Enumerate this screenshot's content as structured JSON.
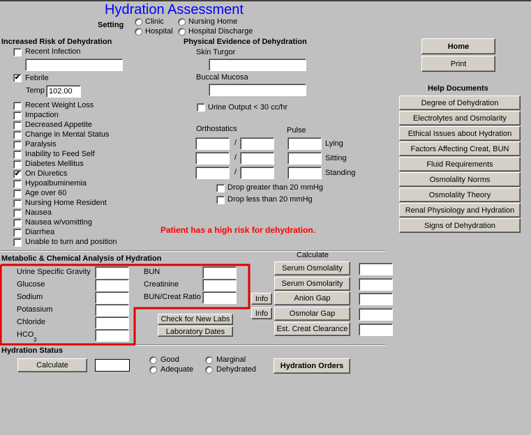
{
  "title": "Hydration Assessment",
  "setting": {
    "label": "Setting",
    "options": [
      "Clinic",
      "Nursing Home",
      "Hospital",
      "Hospital Discharge"
    ]
  },
  "risk": {
    "heading": "Increased Risk of Dehydration",
    "recent_infection": "Recent Infection",
    "recent_infection_value": "",
    "febrile": "Febrile",
    "febrile_checked": true,
    "temp_label": "Temp",
    "temp_value": "102.00",
    "items": [
      {
        "label": "Recent Weight Loss",
        "checked": false
      },
      {
        "label": "Impaction",
        "checked": false
      },
      {
        "label": "Decreased Appetite",
        "checked": false
      },
      {
        "label": "Change in Mental Status",
        "checked": false
      },
      {
        "label": "Paralysis",
        "checked": false
      },
      {
        "label": "Inability to Feed Self",
        "checked": false
      },
      {
        "label": "Diabetes Mellitus",
        "checked": false
      },
      {
        "label": "On Diuretics",
        "checked": true
      },
      {
        "label": "Hypoalbuminemia",
        "checked": false
      },
      {
        "label": "Age over 60",
        "checked": false
      },
      {
        "label": "Nursing Home Resident",
        "checked": false
      },
      {
        "label": "Nausea",
        "checked": false
      },
      {
        "label": "Nausea w/vomitting",
        "checked": false
      },
      {
        "label": "Diarrhea",
        "checked": false
      },
      {
        "label": "Unable to turn and position",
        "checked": false
      }
    ]
  },
  "physical": {
    "heading": "Physical Evidence of Dehydration",
    "skin_turgor": "Skin Turgor",
    "buccal_mucosa": "Buccal Mucosa",
    "urine_output": "Urine Output < 30 cc/hr",
    "orthostatics": "Orthostatics",
    "pulse": "Pulse",
    "slash": "/",
    "positions": [
      "Lying",
      "Sitting",
      "Standing"
    ],
    "drop_greater": "Drop greater than 20 mmHg",
    "drop_less": "Drop less than 20 mmHg"
  },
  "alert": "Patient has a high risk for dehydration.",
  "alert_color": "#ff0000",
  "nav": {
    "home": "Home",
    "print": "Print"
  },
  "help": {
    "heading": "Help Documents",
    "items": [
      "Degree of Dehydration",
      "Electrolytes and Osmolarity",
      "Ethical Issues about Hydration",
      "Factors Affecting Creat, BUN",
      "Fluid Requirements",
      "Osmolality Norms",
      "Osmolality Theory",
      "Renal Physiology and Hydration",
      "Signs of Dehydration"
    ]
  },
  "metabolic": {
    "heading": "Metabolic & Chemical Analysis of Hydration",
    "labs_left": [
      "Urine Specific Gravity",
      "Glucose",
      "Sodium",
      "Potassium",
      "Chloride"
    ],
    "hco": "HCO",
    "hco_sub": "3",
    "labs_right": [
      "BUN",
      "Creatinine",
      "BUN/Creat Ratio"
    ],
    "check_labs": "Check for New Labs",
    "lab_dates": "Laboratory Dates",
    "info": "Info",
    "calculate_label": "Calculate",
    "calc_buttons": [
      "Serum Osmolality",
      "Serum Osmolarity",
      "Anion Gap",
      "Osmolar Gap",
      "Est. Creat Clearance"
    ],
    "highlight_color": "#e00000"
  },
  "status": {
    "heading": "Hydration Status",
    "calculate": "Calculate",
    "options": [
      "Good",
      "Adequate",
      "Marginal",
      "Dehydrated"
    ],
    "orders": "Hydration Orders"
  }
}
